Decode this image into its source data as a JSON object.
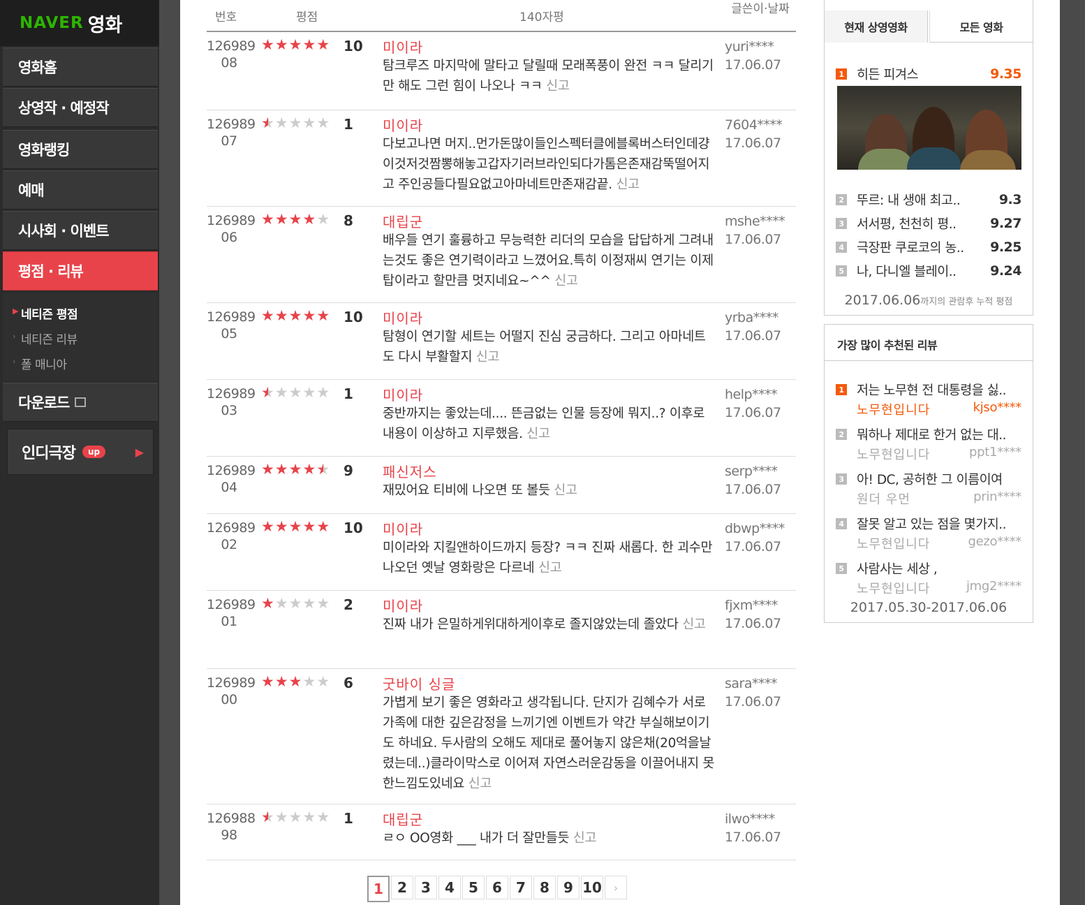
{
  "logo": {
    "naver": "NAVER",
    "movie": "영화"
  },
  "nav": [
    {
      "label": "영화홈"
    },
    {
      "label": "상영작 · 예정작"
    },
    {
      "label": "영화랭킹"
    },
    {
      "label": "예매"
    },
    {
      "label": "시사회 · 이벤트"
    },
    {
      "label": "평점 · 리뷰"
    }
  ],
  "subnav": [
    {
      "label": "네티즌 평점"
    },
    {
      "label": "네티즌 리뷰"
    },
    {
      "label": "폴 매니아"
    }
  ],
  "download": {
    "label": "다운로드"
  },
  "indie": {
    "label": "인디극장",
    "badge": "up"
  },
  "table": {
    "headers": {
      "no": "번호",
      "rating": "평점",
      "review": "140자평",
      "writer": "글쓴이·날짜"
    },
    "report_label": "신고",
    "rows": [
      {
        "no1": "126989",
        "no2": "08",
        "score": "10",
        "stars": 5,
        "title": "미이라",
        "text": "탐크루즈 마지막에 말타고 달릴때 모래폭풍이 완전 ㅋㅋ 달리기만 해도 그런 힘이 나오나 ㅋㅋ",
        "user": "yuri****",
        "date": "17.06.07"
      },
      {
        "no1": "126989",
        "no2": "07",
        "score": "1",
        "stars": 0.5,
        "title": "미이라",
        "text": "다보고나면 머지..먼가돈많이들인스펙터클에블록버스터인데걍이것저것짬뽕해놓고갑자기러브라인되다가톰은존재감뚝떨어지고 주인공들다필요없고아마네트만존재감끝.",
        "user": "7604****",
        "date": "17.06.07"
      },
      {
        "no1": "126989",
        "no2": "06",
        "score": "8",
        "stars": 4,
        "title": "대립군",
        "text": "배우들 연기 훌륭하고 무능력한 리더의 모습을 답답하게 그려내는것도 좋은 연기력이라고 느꼈어요.특히 이정재씨 연기는 이제 탑이라고 할만큼 멋지네요~^^",
        "user": "mshe****",
        "date": "17.06.07"
      },
      {
        "no1": "126989",
        "no2": "05",
        "score": "10",
        "stars": 5,
        "title": "미이라",
        "text": "탐형이 연기할 세트는 어떨지 진심 궁금하다. 그리고 아마네트도 다시 부활할지",
        "user": "yrba****",
        "date": "17.06.07"
      },
      {
        "no1": "126989",
        "no2": "03",
        "score": "1",
        "stars": 0.5,
        "title": "미이라",
        "text": "중반까지는 좋았는데.... 뜬금없는 인물 등장에 뭐지..? 이후로 내용이 이상하고 지루했음.",
        "user": "help****",
        "date": "17.06.07"
      },
      {
        "no1": "126989",
        "no2": "04",
        "score": "9",
        "stars": 4.5,
        "title": "패신저스",
        "text": "재밌어요 티비에 나오면 또 볼듯",
        "user": "serp****",
        "date": "17.06.07"
      },
      {
        "no1": "126989",
        "no2": "02",
        "score": "10",
        "stars": 5,
        "title": "미이라",
        "text": "미이라와 지킬앤하이드까지 등장? ㅋㅋ 진짜 새롭다. 한 괴수만 나오던 옛날 영화랑은 다르네",
        "user": "dbwp****",
        "date": "17.06.07"
      },
      {
        "no1": "126989",
        "no2": "01",
        "score": "2",
        "stars": 1,
        "title": "미이라",
        "text": "진짜 내가 은밀하게위대하게이후로 졸지않았는데 졸았다",
        "user": "fjxm****",
        "date": "17.06.07"
      },
      {
        "no1": "126989",
        "no2": "00",
        "score": "6",
        "stars": 3,
        "title": "굿바이 싱글",
        "text": "가볍게 보기 좋은 영화라고 생각됩니다. 단지가 김혜수가 서로 가족에 대한 깊은감정을 느끼기엔 이벤트가 약간 부실해보이기도 하네요. 두사람의 오해도 제대로 풀어놓지 않은채(20억을날렸는데..)클라이막스로 이어져 자연스러운감동을 이끌어내지 못한느낌도있네요",
        "user": "sara****",
        "date": "17.06.07"
      },
      {
        "no1": "126988",
        "no2": "98",
        "score": "1",
        "stars": 0.5,
        "title": "대립군",
        "text": "ㄹㅇ OO영화 ___ 내가 더 잘만들듯",
        "user": "ilwo****",
        "date": "17.06.07"
      }
    ]
  },
  "pager": {
    "pages": [
      "1",
      "2",
      "3",
      "4",
      "5",
      "6",
      "7",
      "8",
      "9",
      "10"
    ],
    "current": "1",
    "next": "›"
  },
  "ranking": {
    "tabs": [
      "현재 상영영화",
      "모든 영화"
    ],
    "items": [
      {
        "rank": "1",
        "title": "히든 피겨스",
        "score": "9.35"
      },
      {
        "rank": "2",
        "title": "뚜르: 내 생애 최고..",
        "score": "9.3"
      },
      {
        "rank": "3",
        "title": "서서평, 천천히 평..",
        "score": "9.27"
      },
      {
        "rank": "4",
        "title": "극장판 쿠로코의 농..",
        "score": "9.25"
      },
      {
        "rank": "5",
        "title": "나, 다니엘 블레이..",
        "score": "9.24"
      }
    ],
    "footer_date": "2017.06.06",
    "footer_note": "까지의 관람후 누적 평점"
  },
  "best_reviews": {
    "title": "가장 많이 추천된 리뷰",
    "items": [
      {
        "rank": "1",
        "text": "저는 노무현 전 대통령을 싫..",
        "movie": "노무현입니다",
        "user": "kjso****"
      },
      {
        "rank": "2",
        "text": "뭐하나 제대로 한거 없는 대..",
        "movie": "노무현입니다",
        "user": "ppt1****"
      },
      {
        "rank": "3",
        "text": "아! DC, 공허한 그 이름이여",
        "movie": "원더 우먼",
        "user": "prin****"
      },
      {
        "rank": "4",
        "text": "잘못 알고 있는 점을 몇가지..",
        "movie": "노무현입니다",
        "user": "gezo****"
      },
      {
        "rank": "5",
        "text": "사람사는 세상 ,",
        "movie": "노무현입니다",
        "user": "jmg2****"
      }
    ],
    "period": "2017.05.30-2017.06.06"
  },
  "colors": {
    "accent": "#e8434a",
    "rank_top": "#f45a0a",
    "sidebar": "#2b2b2b",
    "logo_green": "#2db400"
  }
}
